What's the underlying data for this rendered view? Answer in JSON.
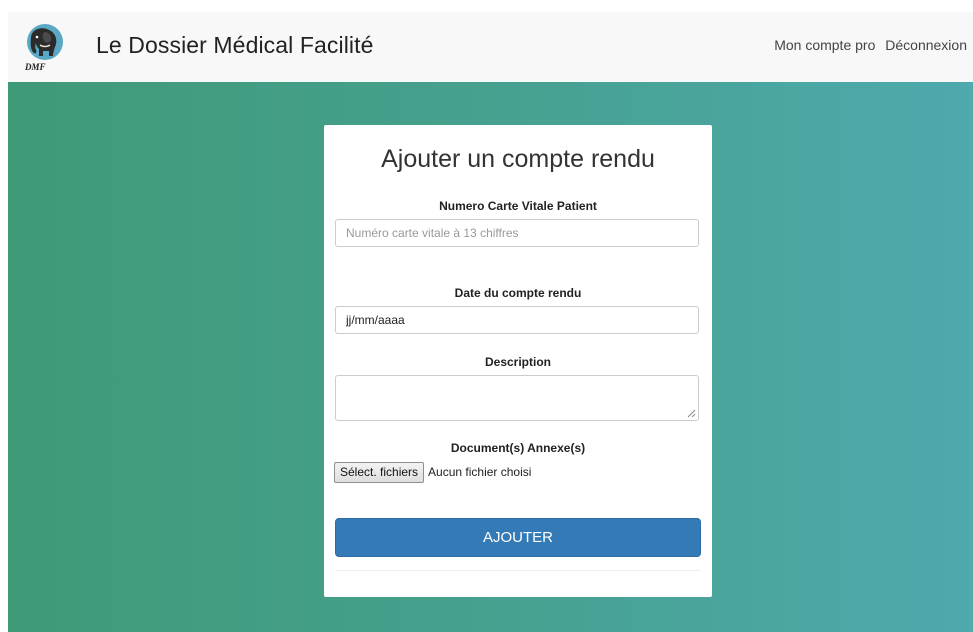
{
  "navbar": {
    "brand": "Le Dossier Médical Facilité",
    "logo_text": "DMF",
    "logo_icon": "elephant-icon",
    "links": [
      "Mon compte pro",
      "Déconnexion"
    ]
  },
  "form": {
    "title": "Ajouter un compte rendu",
    "carte_vitale": {
      "label": "Numero Carte Vitale Patient",
      "placeholder": "Numéro carte vitale à 13 chiffres",
      "value": ""
    },
    "date": {
      "label": "Date du compte rendu",
      "placeholder": "jj/mm/aaaa"
    },
    "description": {
      "label": "Description",
      "value": ""
    },
    "documents": {
      "label": "Document(s) Annexe(s)",
      "button_label": "Sélect. fichiers",
      "status": "Aucun fichier choisi"
    },
    "submit_label": "AJOUTER"
  },
  "colors": {
    "navbar_bg": "#f8f8f8",
    "gradient_start": "#3f9a78",
    "gradient_end": "#4fa9ad",
    "submit_bg": "#337ab7"
  }
}
